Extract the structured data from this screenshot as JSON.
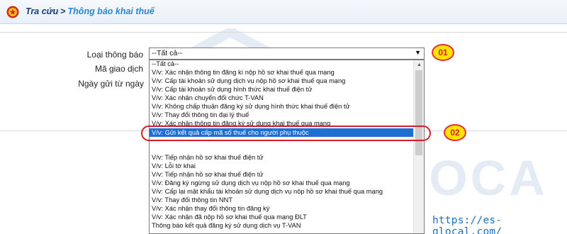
{
  "header": {
    "crumb_root": "Tra cứu",
    "separator": ">",
    "crumb_current": "Thông báo khai thuế"
  },
  "form": {
    "type_label": "Loại thông báo",
    "transaction_label": "Mã giao dịch",
    "date_label": "Ngày gửi từ ngày",
    "selected_value": "--Tất cả--"
  },
  "dropdown": {
    "options": [
      "--Tất cả--",
      "V/v: Xác nhận thông tin đăng kí nộp hồ sơ khai thuế qua mạng",
      "V/v: Cấp tài khoản sử dụng dịch vụ nộp hồ sơ khai thuế qua mạng",
      "V/v: Cấp tài khoản sử dụng hình thức khai thuế điện tử",
      "V/v: Xác nhận chuyển đổi chức T-VAN",
      "V/v: Không chấp thuận đăng ký sử dụng hình thức khai thuế điện tử",
      "V/v: Thay đổi thông tin đại lý thuế",
      "V/v: Xác nhận thông tin đăng ký sử dụng khai thuế qua mạng",
      "V/v: Gửi kết quả cấp mã số thuế cho người phụ thuộc",
      "",
      "V/v: Tiếp nhận hồ sơ khai thuế điện tử",
      "V/v: Lỗi tờ khai",
      "V/v: Tiếp nhận hồ sơ khai thuế điện tử",
      "V/v: Đăng ký ngừng sử dụng dịch vụ nộp hồ sơ khai thuế qua mạng",
      "V/v: Cấp lại mật khẩu tài khoản sử dụng dịch vụ nộp hồ sơ khai thuế qua mạng",
      "V/v: Thay đổi thông tin NNT",
      "V/v: Xác nhận thay đổi thông tin đăng ký",
      "V/v: Xác nhận đã nộp hồ sơ khai thuế qua mạng ĐLT",
      "Thông báo kết quả đăng ký sử dụng dịch vụ T-VAN"
    ],
    "selected_index": 8
  },
  "callouts": {
    "badge_1": "01",
    "badge_2": "02"
  },
  "watermark": "es-glocal",
  "footer_url": "https://es-glocal.com/",
  "colors": {
    "crumb_root": "#153d74",
    "crumb_current": "#2a86cc",
    "selected_bg": "#1e6ed3",
    "callout_fill": "#ffe200",
    "callout_border": "#d21e2e",
    "url": "#1d6fb8"
  }
}
